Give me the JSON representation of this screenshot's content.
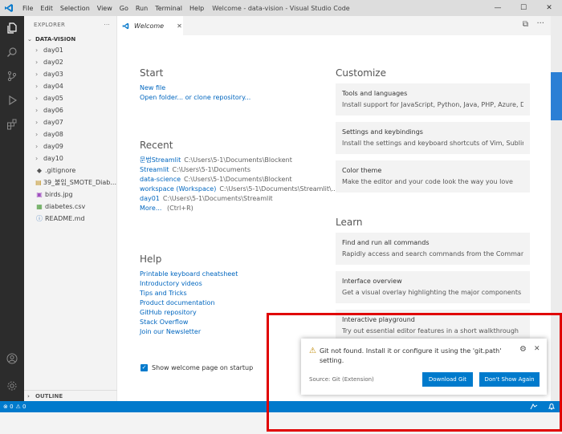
{
  "titlebar": {
    "menu": [
      "File",
      "Edit",
      "Selection",
      "View",
      "Go",
      "Run",
      "Terminal",
      "Help"
    ],
    "title": "Welcome - data-vision - Visual Studio Code",
    "controls": [
      "—",
      "☐",
      "✕"
    ]
  },
  "activity": {
    "icons": [
      "explorer-icon",
      "search-icon",
      "source-control-icon",
      "run-debug-icon",
      "extensions-icon",
      "account-icon",
      "settings-gear-icon"
    ]
  },
  "sidebar": {
    "header": "EXPLORER",
    "more": "···",
    "folder": "DATA-VISION",
    "items": [
      {
        "label": "day01",
        "type": "folder"
      },
      {
        "label": "day02",
        "type": "folder"
      },
      {
        "label": "day03",
        "type": "folder"
      },
      {
        "label": "day04",
        "type": "folder"
      },
      {
        "label": "day05",
        "type": "folder"
      },
      {
        "label": "day06",
        "type": "folder"
      },
      {
        "label": "day07",
        "type": "folder"
      },
      {
        "label": "day08",
        "type": "folder"
      },
      {
        "label": "day09",
        "type": "folder"
      },
      {
        "label": "day10",
        "type": "folder"
      },
      {
        "label": ".gitignore",
        "type": "file",
        "icon": "◆",
        "color": "#555555"
      },
      {
        "label": "39_불임_SMOTE_Diab...",
        "type": "file",
        "icon": "▤",
        "color": "#c09020"
      },
      {
        "label": "birds.jpg",
        "type": "file",
        "icon": "▣",
        "color": "#a050c0"
      },
      {
        "label": "diabetes.csv",
        "type": "file",
        "icon": "▦",
        "color": "#4a9a3a"
      },
      {
        "label": "README.md",
        "type": "file",
        "icon": "ⓘ",
        "color": "#4a7fc0"
      }
    ],
    "outline": "OUTLINE"
  },
  "editor": {
    "tab_label": "Welcome",
    "tab_close": "✕",
    "split": "⧉",
    "more": "···"
  },
  "welcome": {
    "start_title": "Start",
    "start_links": [
      "New file",
      "Open folder... or clone repository..."
    ],
    "recent_title": "Recent",
    "recent": [
      {
        "name": "문법Streamlit",
        "path": "C:\\Users\\5-1\\Documents\\Blockent"
      },
      {
        "name": "Streamlit",
        "path": "C:\\Users\\5-1\\Documents"
      },
      {
        "name": "data-science",
        "path": "C:\\Users\\5-1\\Documents\\Blockent"
      },
      {
        "name": "workspace (Workspace)",
        "path": "C:\\Users\\5-1\\Documents\\Streamlit\\..."
      },
      {
        "name": "day01",
        "path": "C:\\Users\\5-1\\Documents\\Streamlit"
      }
    ],
    "more_label": "More...",
    "more_shortcut": "(Ctrl+R)",
    "help_title": "Help",
    "help_links": [
      "Printable keyboard cheatsheet",
      "Introductory videos",
      "Tips and Tricks",
      "Product documentation",
      "GitHub repository",
      "Stack Overflow",
      "Join our Newsletter"
    ],
    "customize_title": "Customize",
    "customize_cards": [
      {
        "title": "Tools and languages",
        "desc": "Install support for JavaScript, Python, Java, PHP, Azure, D..."
      },
      {
        "title": "Settings and keybindings",
        "desc": "Install the settings and keyboard shortcuts of Vim, Sublim..."
      },
      {
        "title": "Color theme",
        "desc": "Make the editor and your code look the way you love"
      }
    ],
    "learn_title": "Learn",
    "learn_cards": [
      {
        "title": "Find and run all commands",
        "desc": "Rapidly access and search commands from the Command..."
      },
      {
        "title": "Interface overview",
        "desc": "Get a visual overlay highlighting the major components o..."
      },
      {
        "title": "Interactive playground",
        "desc": "Try out essential editor features in a short walkthrough"
      }
    ],
    "show_on_startup": "Show welcome page on startup"
  },
  "notification": {
    "message": "Git not found. Install it or configure it using the 'git.path' setting.",
    "source": "Source: Git (Extension)",
    "primary_button": "Download Git",
    "secondary_button": "Don't Show Again"
  },
  "statusbar": {
    "errors": "⊗ 0",
    "warnings": "⚠ 0"
  },
  "colors": {
    "accent": "#007acc",
    "link": "#0066bf",
    "highlight_box": "#e00000"
  }
}
